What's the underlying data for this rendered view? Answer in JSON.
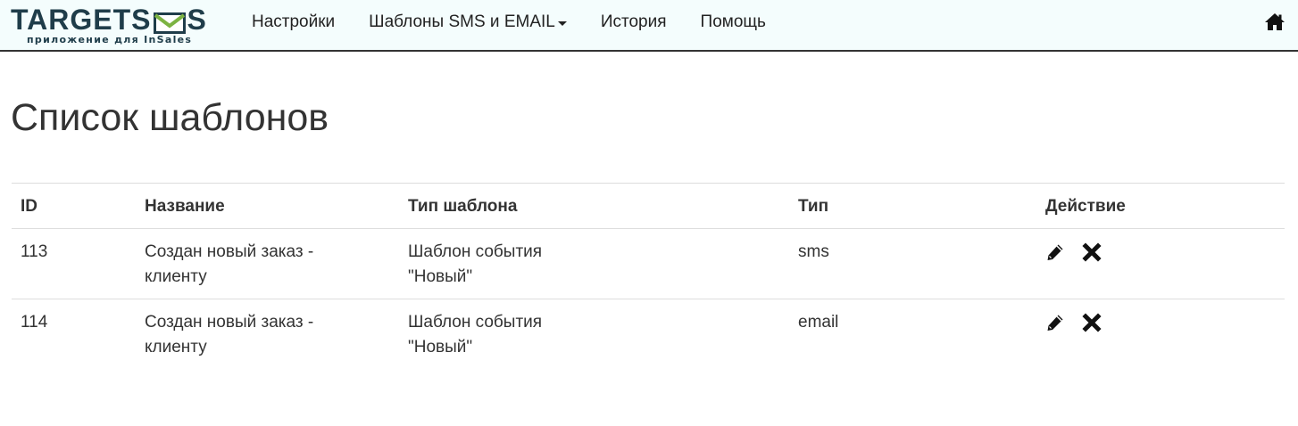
{
  "brand": {
    "name_left": "TARGETS",
    "name_right": "S",
    "subtitle": "приложение для InSales"
  },
  "nav": {
    "items": [
      {
        "label": "Настройки"
      },
      {
        "label": "Шаблоны SMS и EMAIL",
        "has_dropdown": true
      },
      {
        "label": "История"
      },
      {
        "label": "Помощь"
      }
    ],
    "home_icon": "home-icon"
  },
  "page": {
    "title": "Список шаблонов"
  },
  "table": {
    "columns": [
      "ID",
      "Название",
      "Тип шаблона",
      "Тип",
      "Действие"
    ],
    "rows": [
      {
        "id": "113",
        "name": "Создан новый заказ - клиенту",
        "template_type": "Шаблон события \"Новый\"",
        "type": "sms",
        "actions": [
          "pencil-icon",
          "remove-icon"
        ]
      },
      {
        "id": "114",
        "name": "Создан новый заказ - клиенту",
        "template_type": "Шаблон события \"Новый\"",
        "type": "email",
        "actions": [
          "pencil-icon",
          "remove-icon"
        ]
      }
    ]
  },
  "colors": {
    "navbar_bg": "#f4fdfd",
    "brand_text": "#1f3d4a",
    "text": "#333333",
    "border": "#dddddd"
  }
}
